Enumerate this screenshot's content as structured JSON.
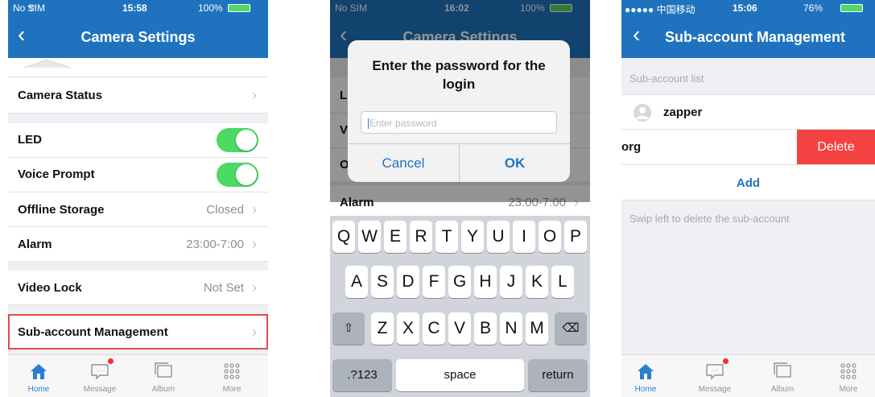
{
  "screen1": {
    "status": {
      "carrier": "No SIM",
      "time": "15:58",
      "battery": "100%"
    },
    "title": "Camera Settings",
    "rows": {
      "camera_status": "Camera Status",
      "led": "LED",
      "voice_prompt": "Voice Prompt",
      "offline_storage": "Offline Storage",
      "offline_storage_value": "Closed",
      "alarm": "Alarm",
      "alarm_value": "23:00-7:00",
      "video_lock": "Video Lock",
      "video_lock_value": "Not Set",
      "sub_account": "Sub-account Management"
    },
    "highlight_color": "#e04a4a"
  },
  "screen2": {
    "status": {
      "carrier": "No SIM",
      "time": "16:02",
      "battery": "100%"
    },
    "title": "Camera Settings",
    "alarm": "Alarm",
    "alarm_value": "23:00-7:00",
    "dialog": {
      "title": "Enter the password for the login",
      "placeholder": "Enter password",
      "cancel": "Cancel",
      "ok": "OK"
    },
    "keyboard": {
      "row1": [
        "Q",
        "W",
        "E",
        "R",
        "T",
        "Y",
        "U",
        "I",
        "O",
        "P"
      ],
      "row2": [
        "A",
        "S",
        "D",
        "F",
        "G",
        "H",
        "J",
        "K",
        "L"
      ],
      "row3": [
        "Z",
        "X",
        "C",
        "V",
        "B",
        "N",
        "M"
      ],
      "numbers": ".?123",
      "space": "space",
      "return": "return"
    }
  },
  "screen3": {
    "status": {
      "carrier": "●●●●● 中国移动",
      "time": "15:06",
      "battery": "76%"
    },
    "title": "Sub-account Management",
    "list_header": "Sub-account list",
    "accounts": [
      "zapper",
      "org"
    ],
    "delete": "Delete",
    "add": "Add",
    "hint": "Swip left to delete the sub-account"
  },
  "tabs": [
    "Home",
    "Message",
    "Album",
    "More"
  ],
  "colors": {
    "nav": "#1f73be",
    "toggle_on": "#4cd964",
    "delete": "#f44242"
  }
}
